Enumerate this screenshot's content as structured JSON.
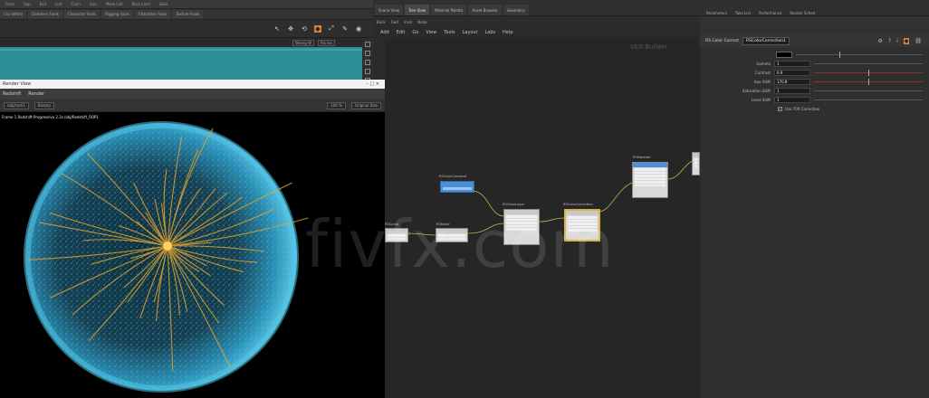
{
  "left_panel": {
    "topbar_items": [
      "Form",
      "Sop",
      "Exit",
      "Lnd",
      "Conn",
      "Lisa",
      "Mesa Lixt",
      "Bliss Land",
      "Lbox"
    ],
    "shelf_tabs": [
      "Crp deforn",
      "Dahdeen Fools",
      "Character Fools",
      "Rigging Fools",
      "Character Fools",
      "Texture Fools"
    ],
    "viewport_buttons": [
      "Wrong W",
      "Ris loc"
    ],
    "float_window_title": "Render View",
    "float_window_controls": "–  □  ×",
    "float_menu": [
      "Redshift",
      "Render"
    ],
    "render_toolbar": {
      "camera": "/obj/cam1",
      "aov": "Beauty",
      "zoom": "100 %",
      "size": "Original Size"
    },
    "render_status": "Frame 1  Redshift  Progressive 2.3s  /obj/Redshift_ROP1"
  },
  "node_editor": {
    "tabs": [
      "Scene View",
      "Tree View",
      "Material Palette",
      "Asset Browser",
      "Geometry"
    ],
    "toolbar": [
      "Back",
      "Fwd",
      "/mat",
      "Node"
    ],
    "menu": [
      "Add",
      "Edit",
      "Go",
      "View",
      "Tools",
      "Layout",
      "Labs",
      "Help"
    ],
    "watermark": "VEX Builder",
    "nodes": [
      {
        "label": "RSColorConstant",
        "rows": 1
      },
      {
        "label": "RSNoise",
        "rows": 2
      },
      {
        "label": "RSColorLayer",
        "rows": 5
      },
      {
        "label": "RSColorCorrection",
        "rows": 5
      },
      {
        "label": "RSMaterial",
        "rows": 6
      },
      {
        "label": "RSConst",
        "rows": 2
      },
      {
        "label": "redshift_vopnet",
        "rows": 3
      }
    ]
  },
  "params": {
    "tabs": [
      "Parameters",
      "Take List",
      "Performance",
      "Render Sched"
    ],
    "node_type": "RS Color Correct",
    "node_name": "RSColorCorrection1",
    "rows": [
      {
        "label": "Gamma",
        "value": "1"
      },
      {
        "label": "Contrast",
        "value": "0.9"
      },
      {
        "label": "Hue Shift",
        "value": "170.8"
      },
      {
        "label": "Saturation Shift",
        "value": "1"
      },
      {
        "label": "Level Shift",
        "value": "1"
      }
    ],
    "swatch_color": "#000000",
    "checkbox_label": "Use 709 Correction",
    "checkbox_checked": true
  },
  "colors": {
    "teal": "#2d8d95",
    "node_blue": "#4b8fd8",
    "selected_outline": "#d8b34a",
    "sphere_cyan": "#3fb2d8",
    "sphere_orange": "#e3a22a",
    "accent_orange": "#d4833a"
  },
  "watermark": "fivfx.com"
}
